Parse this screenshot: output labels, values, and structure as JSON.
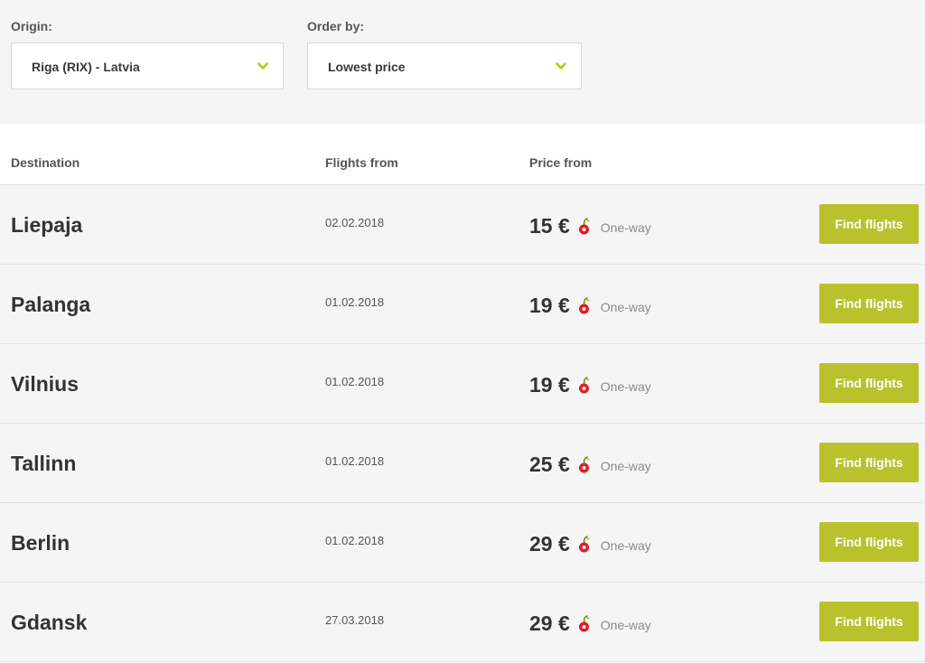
{
  "filters": {
    "origin": {
      "label": "Origin:",
      "value": "Riga (RIX) - Latvia",
      "chevron_icon": "chevron-down-icon"
    },
    "order_by": {
      "label": "Order by:",
      "value": "Lowest price",
      "chevron_icon": "chevron-down-icon"
    }
  },
  "table": {
    "headers": {
      "destination": "Destination",
      "flights_from": "Flights from",
      "price_from": "Price from"
    },
    "rows": [
      {
        "destination": "Liepaja",
        "date": "02.02.2018",
        "price": "15 €",
        "trip": "One-way",
        "button": "Find flights"
      },
      {
        "destination": "Palanga",
        "date": "01.02.2018",
        "price": "19 €",
        "trip": "One-way",
        "button": "Find flights"
      },
      {
        "destination": "Vilnius",
        "date": "01.02.2018",
        "price": "19 €",
        "trip": "One-way",
        "button": "Find flights"
      },
      {
        "destination": "Tallinn",
        "date": "01.02.2018",
        "price": "25 €",
        "trip": "One-way",
        "button": "Find flights"
      },
      {
        "destination": "Berlin",
        "date": "01.02.2018",
        "price": "29 €",
        "trip": "One-way",
        "button": "Find flights"
      },
      {
        "destination": "Gdansk",
        "date": "27.03.2018",
        "price": "29 €",
        "trip": "One-way",
        "button": "Find flights"
      }
    ]
  },
  "icons": {
    "price_icon": "cherry-icon"
  },
  "colors": {
    "accent": "#b9c22c",
    "chevron": "#b5c918",
    "cherry_red": "#e01e25",
    "panel_bg": "#f5f5f5"
  }
}
